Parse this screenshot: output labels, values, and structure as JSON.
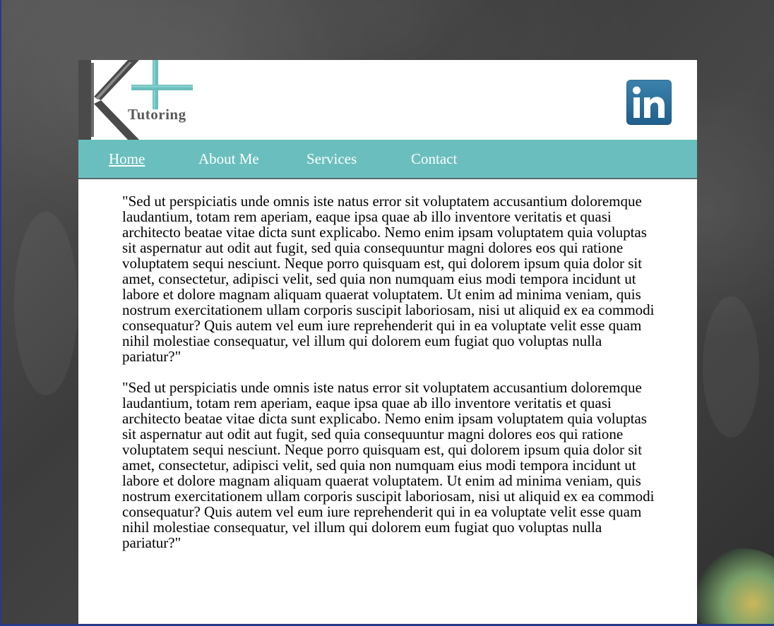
{
  "header": {
    "logo_text": "Tutoring",
    "social_icon": "linkedin-icon"
  },
  "nav": {
    "items": [
      {
        "label": "Home",
        "active": true
      },
      {
        "label": "About Me",
        "active": false
      },
      {
        "label": "Services",
        "active": false
      },
      {
        "label": "Contact",
        "active": false
      }
    ]
  },
  "main": {
    "paragraphs": [
      "\"Sed ut perspiciatis unde omnis iste natus error sit voluptatem accusantium doloremque laudantium, totam rem aperiam, eaque ipsa quae ab illo inventore veritatis et quasi architecto beatae vitae dicta sunt explicabo. Nemo enim ipsam voluptatem quia voluptas sit aspernatur aut odit aut fugit, sed quia consequuntur magni dolores eos qui ratione voluptatem sequi nesciunt. Neque porro quisquam est, qui dolorem ipsum quia dolor sit amet, consectetur, adipisci velit, sed quia non numquam eius modi tempora incidunt ut labore et dolore magnam aliquam quaerat voluptatem. Ut enim ad minima veniam, quis nostrum exercitationem ullam corporis suscipit laboriosam, nisi ut aliquid ex ea commodi consequatur? Quis autem vel eum iure reprehenderit qui in ea voluptate velit esse quam nihil molestiae consequatur, vel illum qui dolorem eum fugiat quo voluptas nulla pariatur?\"",
      "\"Sed ut perspiciatis unde omnis iste natus error sit voluptatem accusantium doloremque laudantium, totam rem aperiam, eaque ipsa quae ab illo inventore veritatis et quasi architecto beatae vitae dicta sunt explicabo. Nemo enim ipsam voluptatem quia voluptas sit aspernatur aut odit aut fugit, sed quia consequuntur magni dolores eos qui ratione voluptatem sequi nesciunt. Neque porro quisquam est, qui dolorem ipsum quia dolor sit amet, consectetur, adipisci velit, sed quia non numquam eius modi tempora incidunt ut labore et dolore magnam aliquam quaerat voluptatem. Ut enim ad minima veniam, quis nostrum exercitationem ullam corporis suscipit laboriosam, nisi ut aliquid ex ea commodi consequatur? Quis autem vel eum iure reprehenderit qui in ea voluptate velit esse quam nihil molestiae consequatur, vel illum qui dolorem eum fugiat quo voluptas nulla pariatur?\""
    ]
  },
  "colors": {
    "nav_background": "#6abfbe",
    "logo_teal": "#6abfbe",
    "logo_gray": "#4a4a4a",
    "linkedin_blue": "#2a6f9b"
  }
}
